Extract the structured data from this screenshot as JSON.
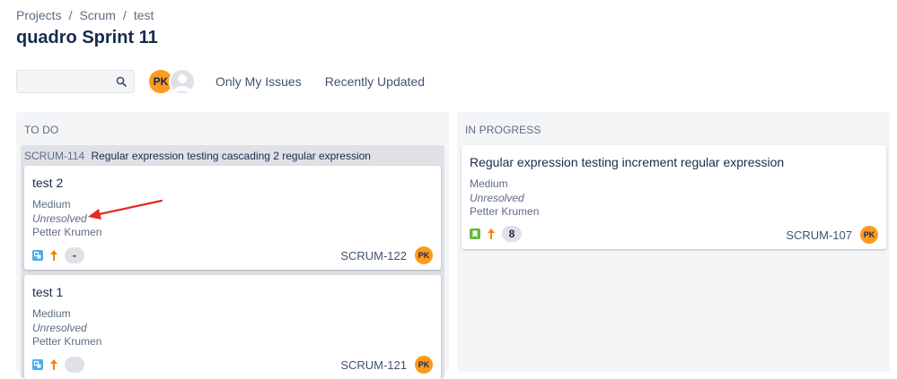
{
  "breadcrumb": {
    "items": [
      "Projects",
      "Scrum",
      "test"
    ],
    "separator": "/"
  },
  "page": {
    "title": "quadro Sprint 11"
  },
  "toolbar": {
    "search_value": "",
    "search_icon": "search-icon",
    "avatar_initials": "PK",
    "filters": [
      "Only My Issues",
      "Recently Updated"
    ]
  },
  "columns": [
    {
      "title": "TO DO"
    },
    {
      "title": "IN PROGRESS"
    }
  ],
  "parent": {
    "key": "SCRUM-114",
    "summary": "Regular expression testing cascading 2 regular expression"
  },
  "cards": [
    {
      "summary": "test 2",
      "priority": "Medium",
      "resolution": "Unresolved",
      "assignee": "Petter Krumen",
      "estimate": "-",
      "key": "SCRUM-122",
      "avatar": "PK",
      "type_icon": "subtask-icon",
      "priority_icon": "priority-medium-icon"
    },
    {
      "summary": "test 1",
      "priority": "Medium",
      "resolution": "Unresolved",
      "assignee": "Petter Krumen",
      "estimate": "",
      "key": "SCRUM-121",
      "avatar": "PK",
      "type_icon": "subtask-icon",
      "priority_icon": "priority-medium-icon"
    },
    {
      "summary": "Regular expression testing increment regular expression",
      "priority": "Medium",
      "resolution": "Unresolved",
      "assignee": "Petter Krumen",
      "estimate": "8",
      "key": "SCRUM-107",
      "avatar": "PK",
      "type_icon": "story-icon",
      "priority_icon": "priority-medium-icon"
    }
  ],
  "colors": {
    "avatar": "#ff991f",
    "subtask": "#4bade8",
    "story": "#63ba3c",
    "priority": "#ff7f00",
    "annotation_arrow": "#e5291f"
  }
}
